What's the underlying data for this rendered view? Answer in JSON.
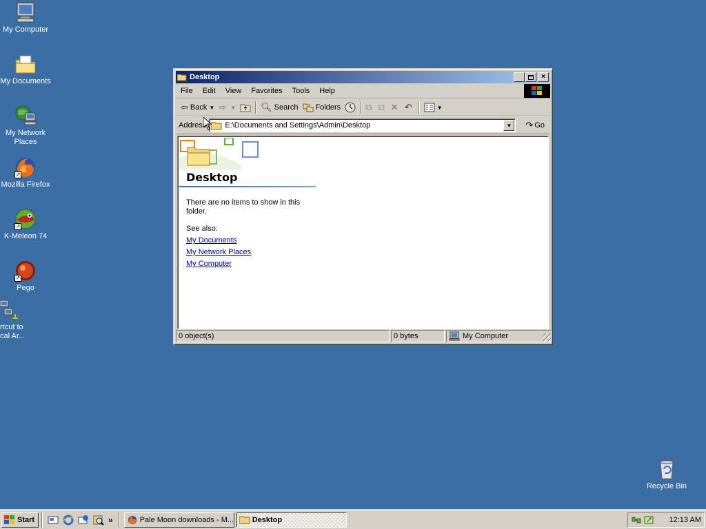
{
  "desktop": {
    "icons": [
      {
        "label": "My Computer",
        "icon": "my-computer-icon"
      },
      {
        "label": "My Documents",
        "icon": "my-documents-icon"
      },
      {
        "label": "My Network Places",
        "icon": "network-places-icon"
      },
      {
        "label": "Mozilla Firefox",
        "icon": "firefox-icon"
      },
      {
        "label": "K-Meleon 74",
        "icon": "k-meleon-icon"
      },
      {
        "label": "Pego",
        "icon": "pego-icon"
      },
      {
        "label": "rtcut to\ncal Ar...",
        "icon": "network-shortcut-icon"
      },
      {
        "label": "Recycle Bin",
        "icon": "recycle-bin-icon"
      }
    ]
  },
  "window": {
    "title": "Desktop",
    "menu": [
      "File",
      "Edit",
      "View",
      "Favorites",
      "Tools",
      "Help"
    ],
    "toolbar": {
      "back_label": "Back",
      "search_label": "Search",
      "folders_label": "Folders"
    },
    "address": {
      "label": "Address",
      "value": "E:\\Documents and Settings\\Admin\\Desktop",
      "go_label": "Go"
    },
    "content": {
      "heading": "Desktop",
      "empty_message": "There are no items to show in this folder.",
      "see_also_label": "See also:",
      "links": [
        "My Documents",
        "My Network Places",
        "My Computer"
      ]
    },
    "status": {
      "objects": "0 object(s)",
      "size": "0 bytes",
      "zone": "My Computer"
    }
  },
  "taskbar": {
    "start_label": "Start",
    "tasks": [
      {
        "label": "Pale Moon downloads - M...",
        "active": false
      },
      {
        "label": "Desktop",
        "active": true
      }
    ],
    "clock": "12:13 AM"
  },
  "colors": {
    "desktop": "#3a6ea5",
    "titlebar_start": "#0a246a",
    "titlebar_end": "#a6caf0",
    "link": "#0000a0"
  }
}
